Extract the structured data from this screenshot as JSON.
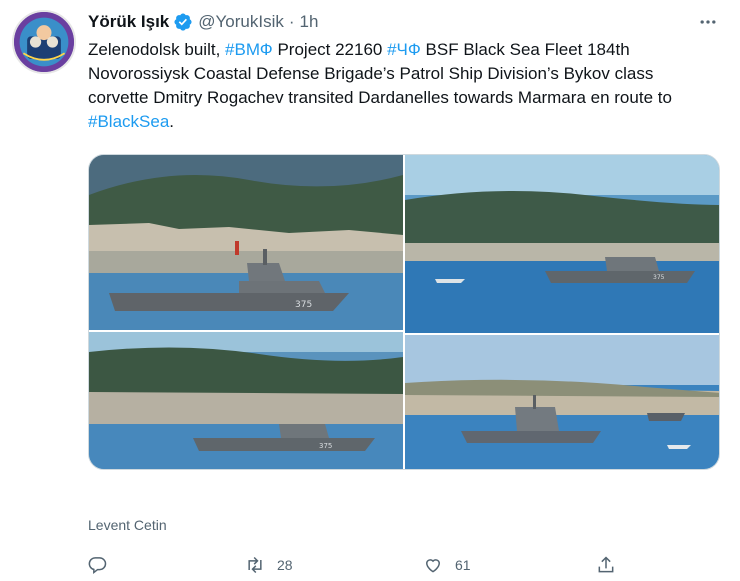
{
  "tweet": {
    "author_name": "Yörük Işık",
    "author_handle": "@YorukIsik",
    "separator": "·",
    "timestamp": "1h",
    "text_parts": [
      {
        "text": "Zelenodolsk built, ",
        "link": false
      },
      {
        "text": "#ВМФ",
        "link": true
      },
      {
        "text": " Project 22160 ",
        "link": false
      },
      {
        "text": "#ЧФ",
        "link": true
      },
      {
        "text": " BSF Black Sea Fleet 184th Novorossiysk Coastal Defense Brigade’s Patrol Ship Division’s Bykov class corvette Dmitry Rogachev transited Dardanelles towards Marmara en route to ",
        "link": false
      },
      {
        "text": "#BlackSea",
        "link": true
      },
      {
        "text": ".",
        "link": false
      }
    ],
    "media_credit": "Levent Cetin",
    "hull_number": "375",
    "retweet_count": "28",
    "like_count": "61"
  },
  "icons": {
    "verified": "verified-badge-icon",
    "more": "more-options-icon",
    "reply": "reply-icon",
    "retweet": "retweet-icon",
    "like": "heart-icon",
    "share": "share-icon"
  },
  "colors": {
    "link": "#1d9bf0",
    "secondary_text": "#536471",
    "verified": "#1d9bf0",
    "avatar_bg": "#6a3fa0"
  }
}
